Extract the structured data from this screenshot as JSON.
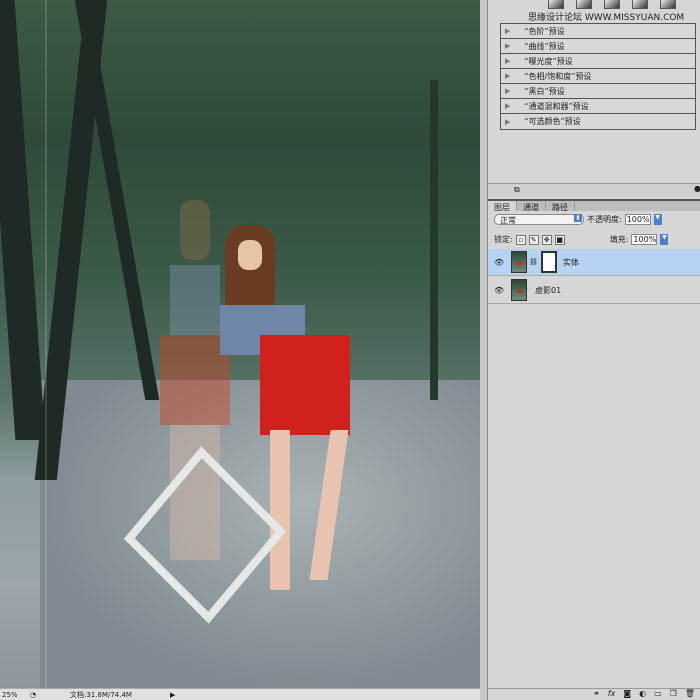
{
  "watermark": "思缘设计论坛 WWW.MISSYUAN.COM",
  "adjustments": {
    "presets": [
      "“色阶”预设",
      "“曲线”预设",
      "“曝光度”预设",
      "“色相/饱和度”预设",
      "“黑白”预设",
      "“通道混和器”预设",
      "“可选颜色”预设"
    ]
  },
  "layers_panel": {
    "tabs": [
      "图层",
      "通道",
      "路径"
    ],
    "blend_mode": "正常",
    "opacity_label": "不透明度:",
    "opacity": "100%",
    "lock_label": "锁定:",
    "fill_label": "填充:",
    "fill": "100%",
    "layers": [
      {
        "name": "实体",
        "selected": true
      },
      {
        "name": "虚影01",
        "selected": false
      }
    ],
    "selected_color": "#b6d2f4"
  },
  "status": {
    "zoom": "25%",
    "doc": "文档:31.8M/74.4M"
  }
}
